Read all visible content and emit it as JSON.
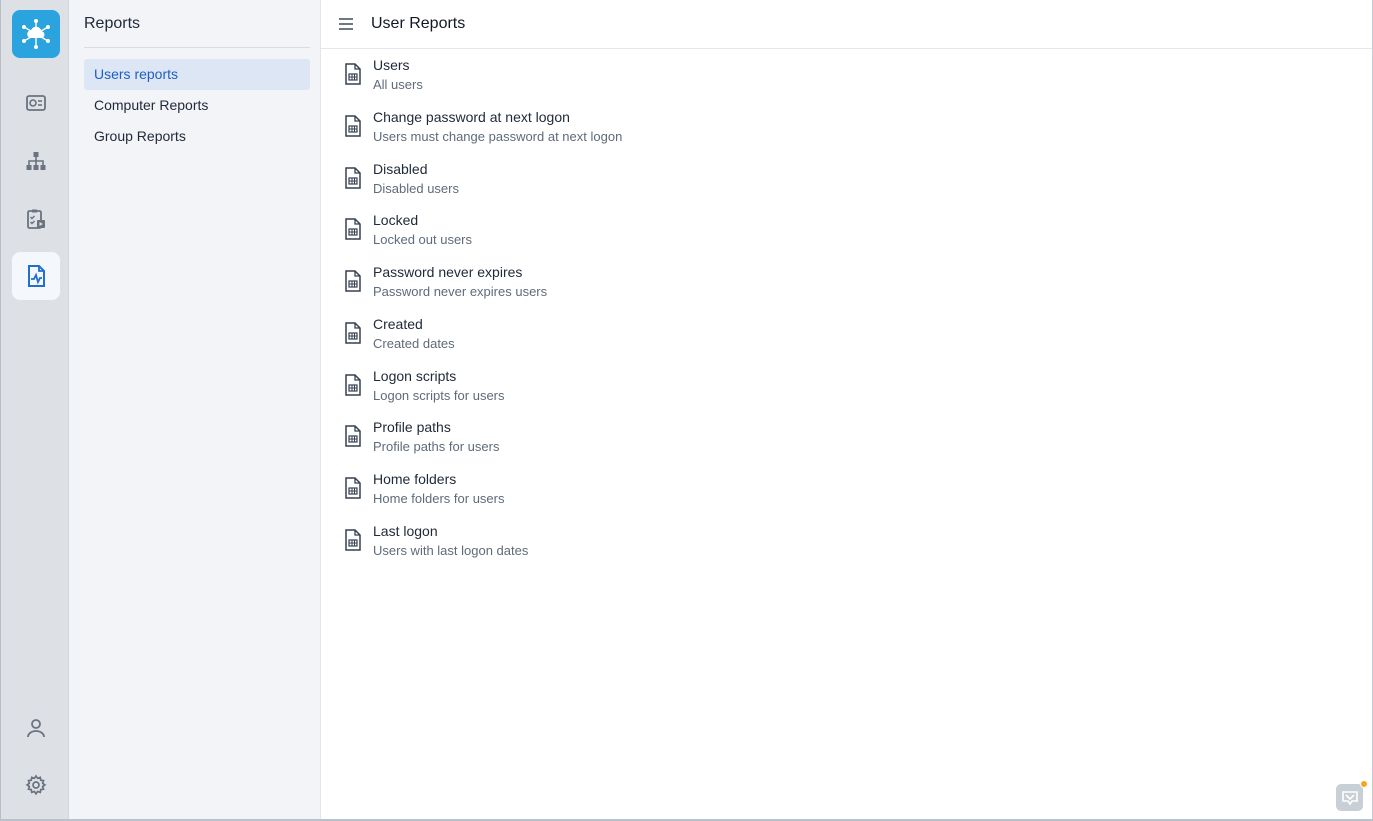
{
  "colors": {
    "accent": "#2aa3df",
    "active_nav_bg": "#dce6f5",
    "active_nav_text": "#1f5fbf",
    "notification_dot": "#f6a623"
  },
  "rail": {
    "logo_icon": "cloud-network-icon",
    "items": [
      {
        "icon": "dashboard-icon"
      },
      {
        "icon": "hierarchy-icon"
      },
      {
        "icon": "clipboard-tasks-icon"
      },
      {
        "icon": "report-chart-icon"
      }
    ],
    "bottom": [
      {
        "icon": "user-icon"
      },
      {
        "icon": "gear-icon"
      }
    ]
  },
  "subnav": {
    "title": "Reports",
    "items": [
      {
        "label": "Users reports"
      },
      {
        "label": "Computer Reports"
      },
      {
        "label": "Group Reports"
      }
    ]
  },
  "main": {
    "title": "User Reports",
    "reports": [
      {
        "title": "Users",
        "subtitle": "All users"
      },
      {
        "title": "Change password at next logon",
        "subtitle": "Users must change password at next logon"
      },
      {
        "title": "Disabled",
        "subtitle": "Disabled users"
      },
      {
        "title": "Locked",
        "subtitle": "Locked out users"
      },
      {
        "title": "Password never expires",
        "subtitle": "Password never expires users"
      },
      {
        "title": "Created",
        "subtitle": "Created dates"
      },
      {
        "title": "Logon scripts",
        "subtitle": "Logon scripts for users"
      },
      {
        "title": "Profile paths",
        "subtitle": "Profile paths for users"
      },
      {
        "title": "Home folders",
        "subtitle": "Home folders for users"
      },
      {
        "title": "Last logon",
        "subtitle": "Users with last logon dates"
      }
    ]
  }
}
